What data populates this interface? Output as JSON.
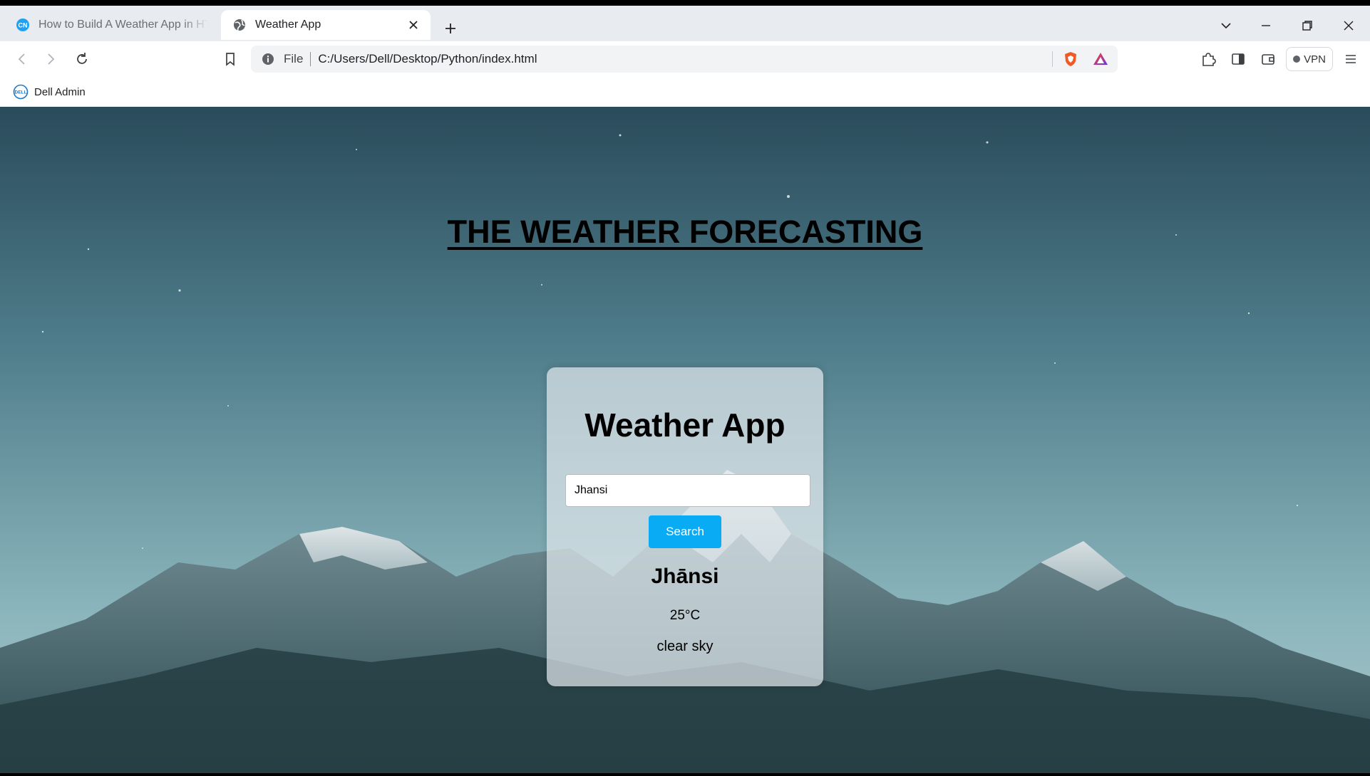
{
  "browser": {
    "tabs": [
      {
        "label": "How to Build A Weather App in HTML",
        "active": false
      },
      {
        "label": "Weather App",
        "active": true
      }
    ],
    "address": {
      "scheme_label": "File",
      "url": "C:/Users/Dell/Desktop/Python/index.html"
    },
    "vpn_label": "VPN",
    "bookmarks": [
      {
        "label": "Dell Admin"
      }
    ]
  },
  "page": {
    "heading": "THE WEATHER FORECASTING",
    "card": {
      "title": "Weather App",
      "input_value": "Jhansi",
      "search_label": "Search",
      "result": {
        "city": "Jhānsi",
        "temperature": "25°C",
        "description": "clear sky"
      }
    }
  },
  "colors": {
    "search_button": "#0aabf5",
    "tab_strip": "#e8ebf0",
    "brave_orange": "#f15a24"
  }
}
